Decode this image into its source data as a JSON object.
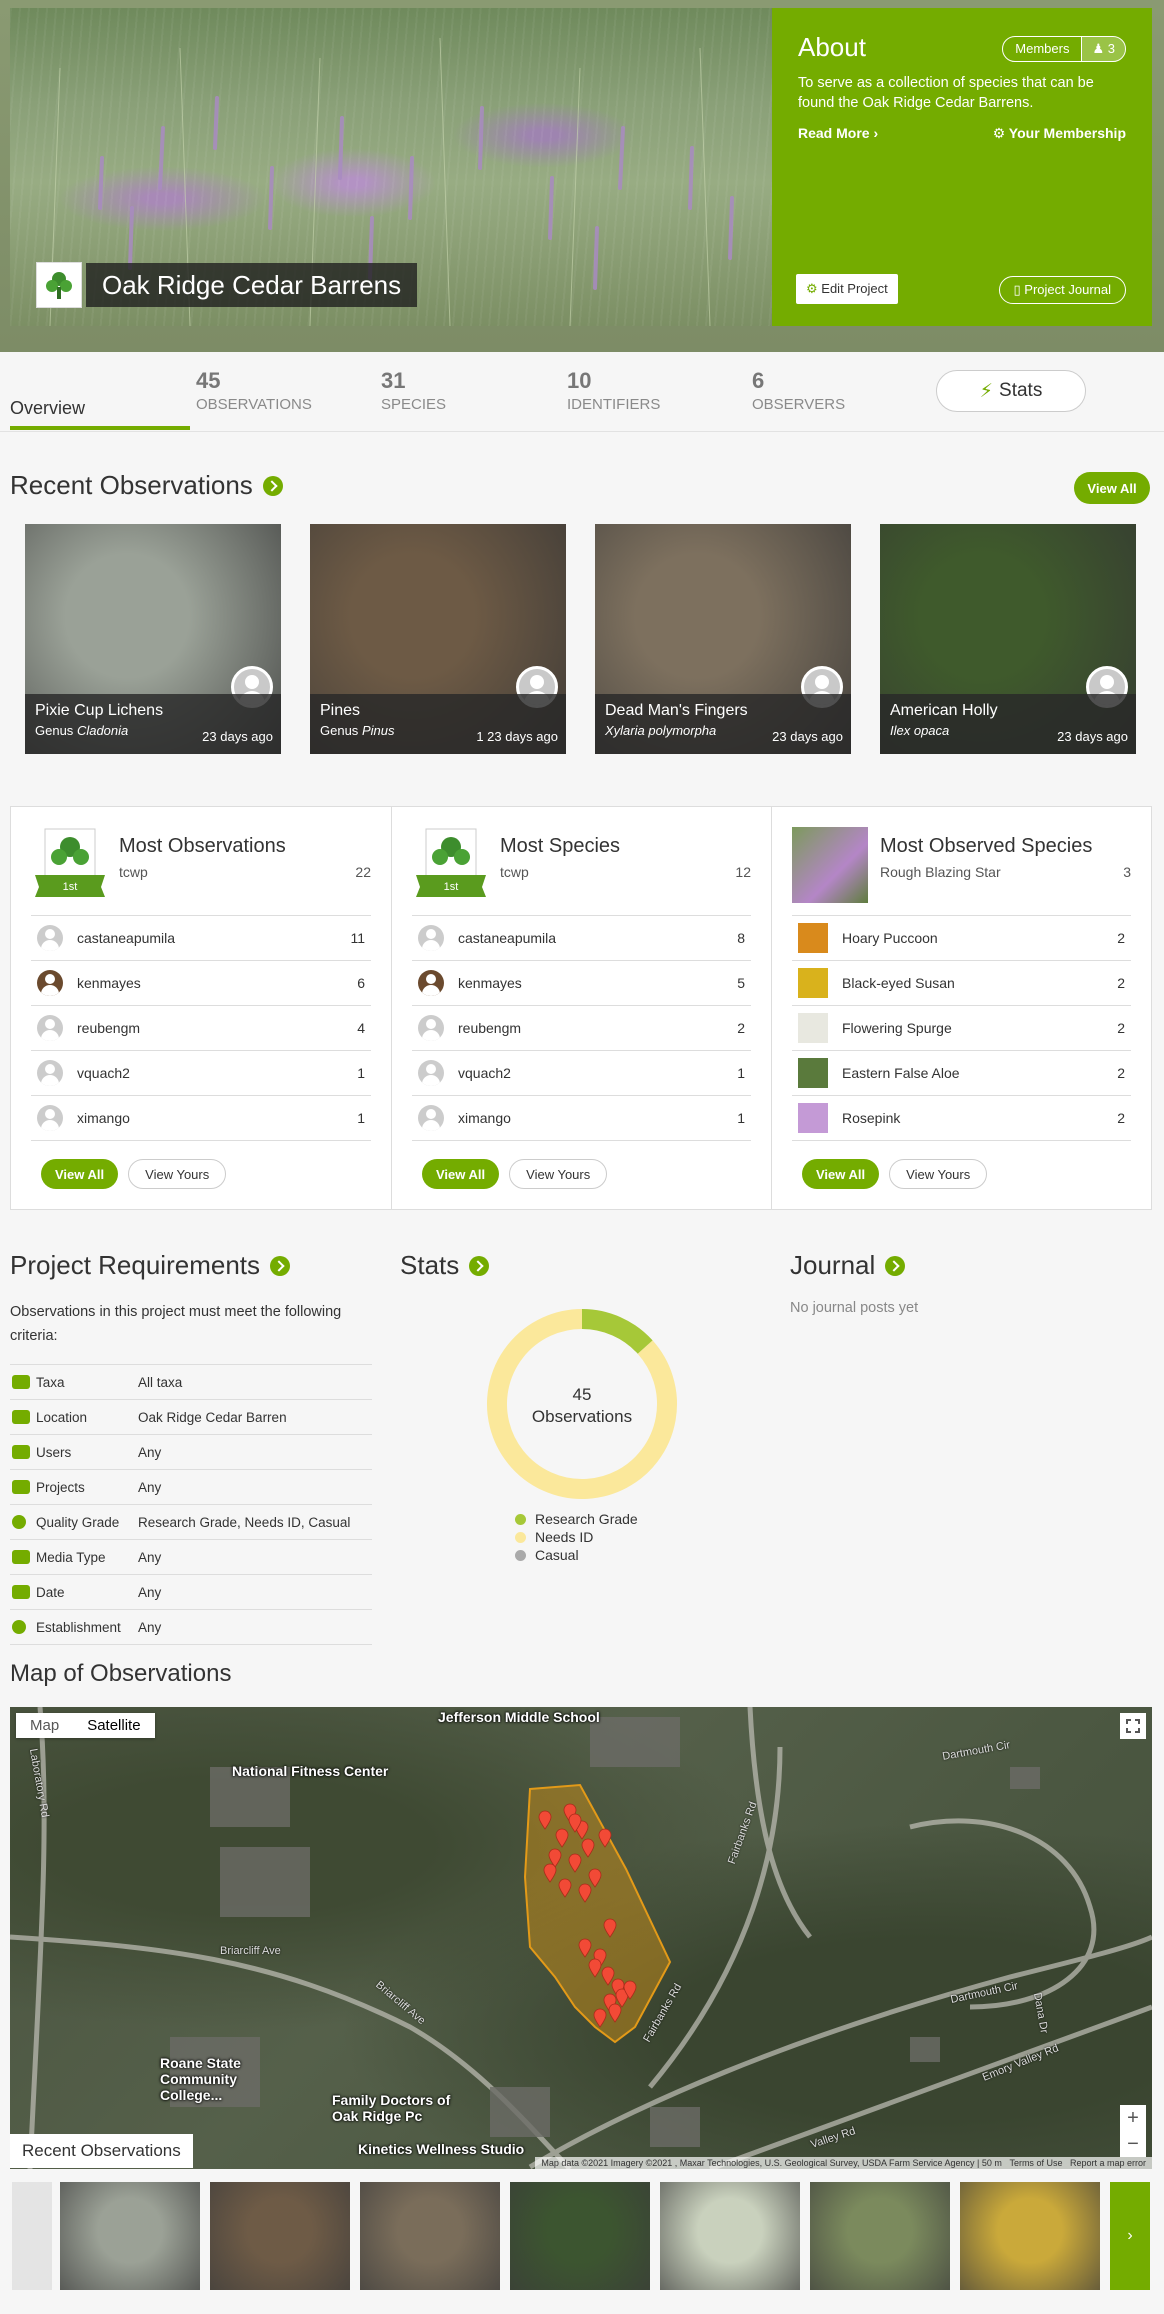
{
  "hero": {
    "project_title": "Oak Ridge Cedar Barrens"
  },
  "about": {
    "heading": "About",
    "members_label": "Members",
    "members_count": "3",
    "description": "To serve as a collection of species that can be found the Oak Ridge Cedar Barrens.",
    "read_more": "Read More",
    "your_membership": "Your Membership",
    "edit_project": "Edit Project",
    "project_journal": "Project Journal"
  },
  "statbar": {
    "overview_tab": "Overview",
    "stats": [
      {
        "n": "45",
        "l": "OBSERVATIONS"
      },
      {
        "n": "31",
        "l": "SPECIES"
      },
      {
        "n": "10",
        "l": "IDENTIFIERS"
      },
      {
        "n": "6",
        "l": "OBSERVERS"
      }
    ],
    "stats_button": "Stats"
  },
  "recent": {
    "heading": "Recent Observations",
    "view_all": "View All",
    "cards": [
      {
        "title": "Pixie Cup Lichens",
        "prefix": "Genus",
        "sci": "Cladonia",
        "date": "23 days ago",
        "color": "#9aa197"
      },
      {
        "title": "Pines",
        "prefix": "Genus",
        "sci": "Pinus",
        "date": "1 23 days ago",
        "color": "#6d5a45"
      },
      {
        "title": "Dead Man's Fingers",
        "prefix": "",
        "sci": "Xylaria polymorpha",
        "date": "23 days ago",
        "color": "#7d705e"
      },
      {
        "title": "American Holly",
        "prefix": "",
        "sci": "Ilex opaca",
        "date": "23 days ago",
        "color": "#3f5a2c"
      }
    ]
  },
  "leaderboards": [
    {
      "title": "Most Observations",
      "top_name": "tcwp",
      "top_count": "22",
      "rows": [
        {
          "name": "castaneapumila",
          "count": "11"
        },
        {
          "name": "kenmayes",
          "count": "6"
        },
        {
          "name": "reubengm",
          "count": "4"
        },
        {
          "name": "vquach2",
          "count": "1"
        },
        {
          "name": "ximango",
          "count": "1"
        }
      ],
      "view_all": "View All",
      "view_yours": "View Yours"
    },
    {
      "title": "Most Species",
      "top_name": "tcwp",
      "top_count": "12",
      "rows": [
        {
          "name": "castaneapumila",
          "count": "8"
        },
        {
          "name": "kenmayes",
          "count": "5"
        },
        {
          "name": "reubengm",
          "count": "2"
        },
        {
          "name": "vquach2",
          "count": "1"
        },
        {
          "name": "ximango",
          "count": "1"
        }
      ],
      "view_all": "View All",
      "view_yours": "View Yours"
    },
    {
      "title": "Most Observed Species",
      "top_name": "Rough Blazing Star",
      "top_count": "3",
      "rows": [
        {
          "name": "Hoary Puccoon",
          "count": "2"
        },
        {
          "name": "Black-eyed Susan",
          "count": "2"
        },
        {
          "name": "Flowering Spurge",
          "count": "2"
        },
        {
          "name": "Eastern False Aloe",
          "count": "2"
        },
        {
          "name": "Rosepink",
          "count": "2"
        }
      ],
      "view_all": "View All",
      "view_yours": "View Yours"
    }
  ],
  "badge_text": "1st",
  "requirements": {
    "heading": "Project Requirements",
    "intro": "Observations in this project must meet the following criteria:",
    "rows": [
      {
        "k": "Taxa",
        "v": "All taxa"
      },
      {
        "k": "Location",
        "v": "Oak Ridge Cedar Barren"
      },
      {
        "k": "Users",
        "v": "Any"
      },
      {
        "k": "Projects",
        "v": "Any"
      },
      {
        "k": "Quality Grade",
        "v": "Research Grade, Needs ID, Casual"
      },
      {
        "k": "Media Type",
        "v": "Any"
      },
      {
        "k": "Date",
        "v": "Any"
      },
      {
        "k": "Establishment",
        "v": "Any"
      }
    ]
  },
  "stats_section": {
    "heading": "Stats",
    "center_count": "45",
    "center_label": "Observations"
  },
  "chart_data": {
    "type": "pie",
    "categories": [
      "Research Grade",
      "Needs ID",
      "Casual"
    ],
    "values": [
      6,
      39,
      0
    ],
    "colors": [
      "#a6c838",
      "#fbe89b",
      "#aaaaaa"
    ],
    "legend": "bottom"
  },
  "journal": {
    "heading": "Journal",
    "empty": "No journal posts yet"
  },
  "map": {
    "heading": "Map of Observations",
    "map_btn": "Map",
    "satellite_btn": "Satellite",
    "labels": {
      "school": "Jefferson Middle School",
      "fitness": "National Fitness Center",
      "roane": "Roane State Community College...",
      "family": "Family Doctors of Oak Ridge Pc",
      "kinetics": "Kinetics Wellness Studio"
    },
    "roads": [
      "Briarcliff Ave",
      "Briarcliff Ave",
      "Fairbanks Rd",
      "Fairbanks Rd",
      "Dartmouth Cir",
      "Dartmouth Cir",
      "Emory Valley Rd",
      "Valley Rd",
      "Laboratory Rd",
      "Dana Dr"
    ],
    "attribution": "Map data ©2021 Imagery ©2021 , Maxar Technologies, U.S. Geological Survey, USDA Farm Service Agency | 50 m",
    "terms": "Terms of Use",
    "report": "Report a map error",
    "recent_label": "Recent Observations"
  },
  "thumbs": [
    "#9ba196",
    "#6e5b46",
    "#7a6d5a",
    "#3c5530",
    "#c9d1bd",
    "#7b8a5d",
    "#caa93a"
  ]
}
